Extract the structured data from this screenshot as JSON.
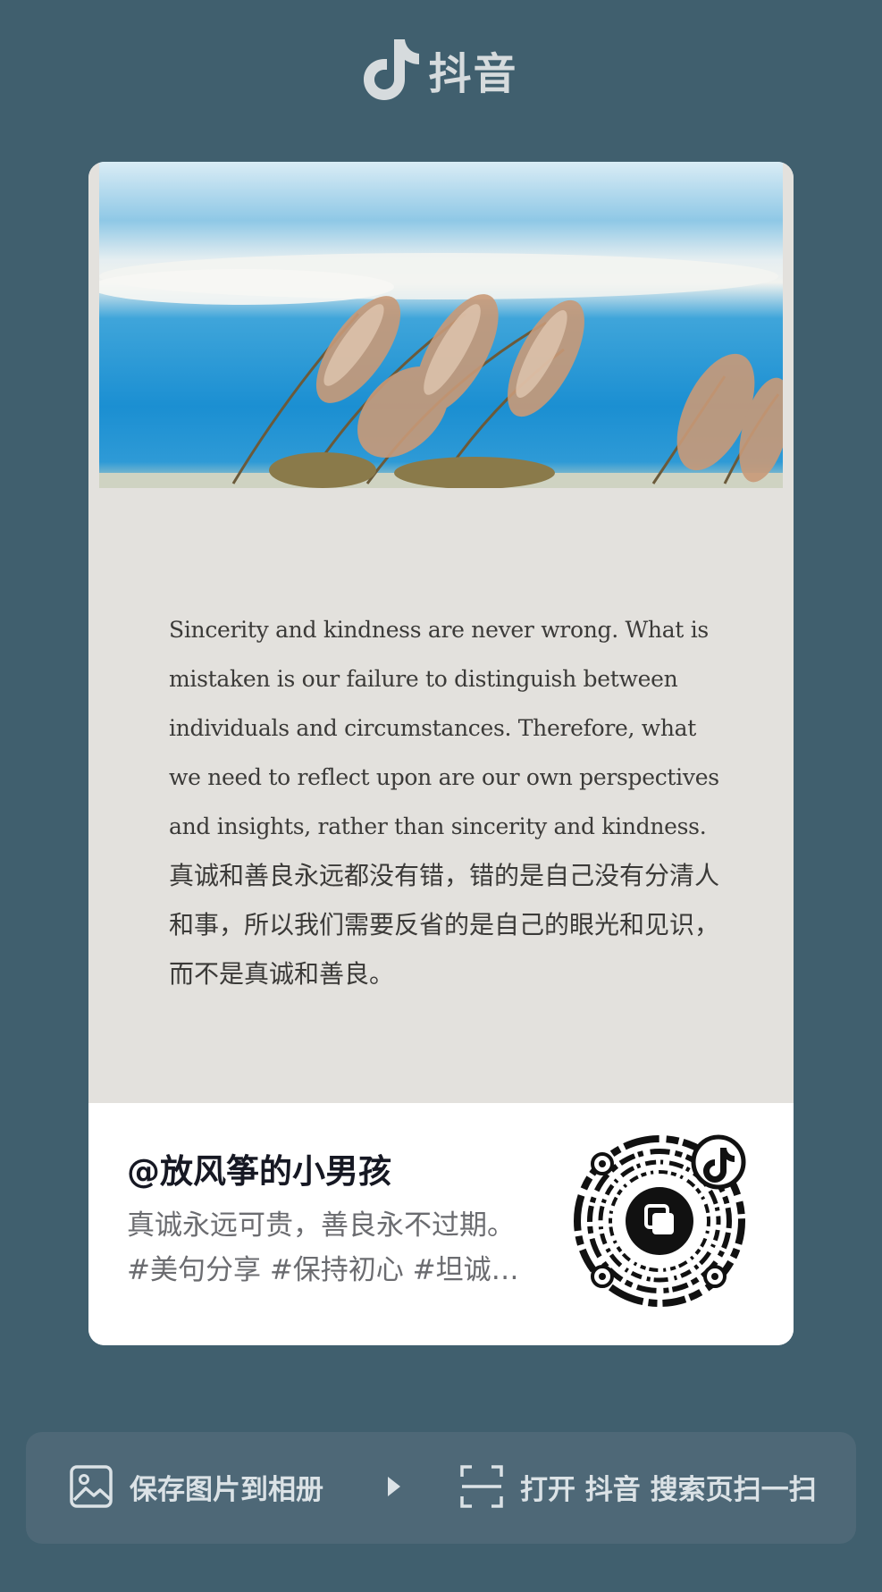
{
  "app": {
    "logo_text": "抖音",
    "bg_color": "#405f6e"
  },
  "post": {
    "quote_en": "Sincerity and kindness are never wrong. What is mistaken is our failure to distinguish between individuals and circumstances. Therefore, what we need to reflect upon are our own perspectives and insights, rather than sincerity and kindness.",
    "quote_zh": "真诚和善良永远都没有错，错的是自己没有分清人和事，所以我们需要反省的是自己的眼光和见识，而不是真诚和善良。"
  },
  "share_card": {
    "author": "@放风筝的小男孩",
    "caption_line1": "真诚永远可贵，善良永不过期。",
    "caption_line2": "#美句分享 #保持初心 #坦诚…",
    "qr_icon": "douyin-qr-code"
  },
  "actions": {
    "save_label": "保存图片到相册",
    "scan_label": "打开 抖音 搜索页扫一扫"
  }
}
